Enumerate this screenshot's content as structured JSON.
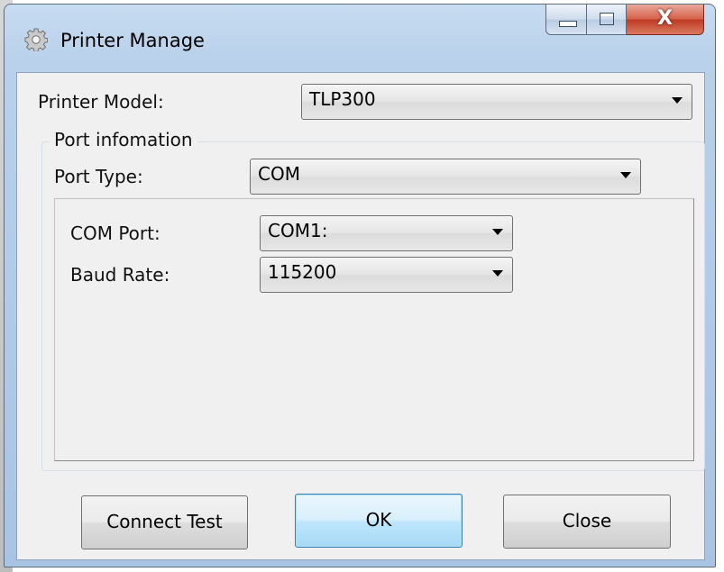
{
  "window": {
    "title": "Printer Manage",
    "icon": "gear-icon",
    "controls": {
      "minimize": "minimize",
      "maximize": "maximize",
      "close_glyph": "X"
    }
  },
  "form": {
    "printer_model": {
      "label": "Printer Model:",
      "value": "TLP300"
    },
    "port_group_title": "Port infomation",
    "port_type": {
      "label": "Port Type:",
      "value": "COM"
    },
    "com_port": {
      "label": "COM Port:",
      "value": "COM1:"
    },
    "baud_rate": {
      "label": "Baud Rate:",
      "value": "115200"
    }
  },
  "buttons": {
    "connect_test": "Connect Test",
    "ok": "OK",
    "close": "Close"
  },
  "colors": {
    "frame": "#b9d1ea",
    "client": "#f0f0f0",
    "close_button": "#c03a23",
    "default_button": "#bee6fd"
  }
}
